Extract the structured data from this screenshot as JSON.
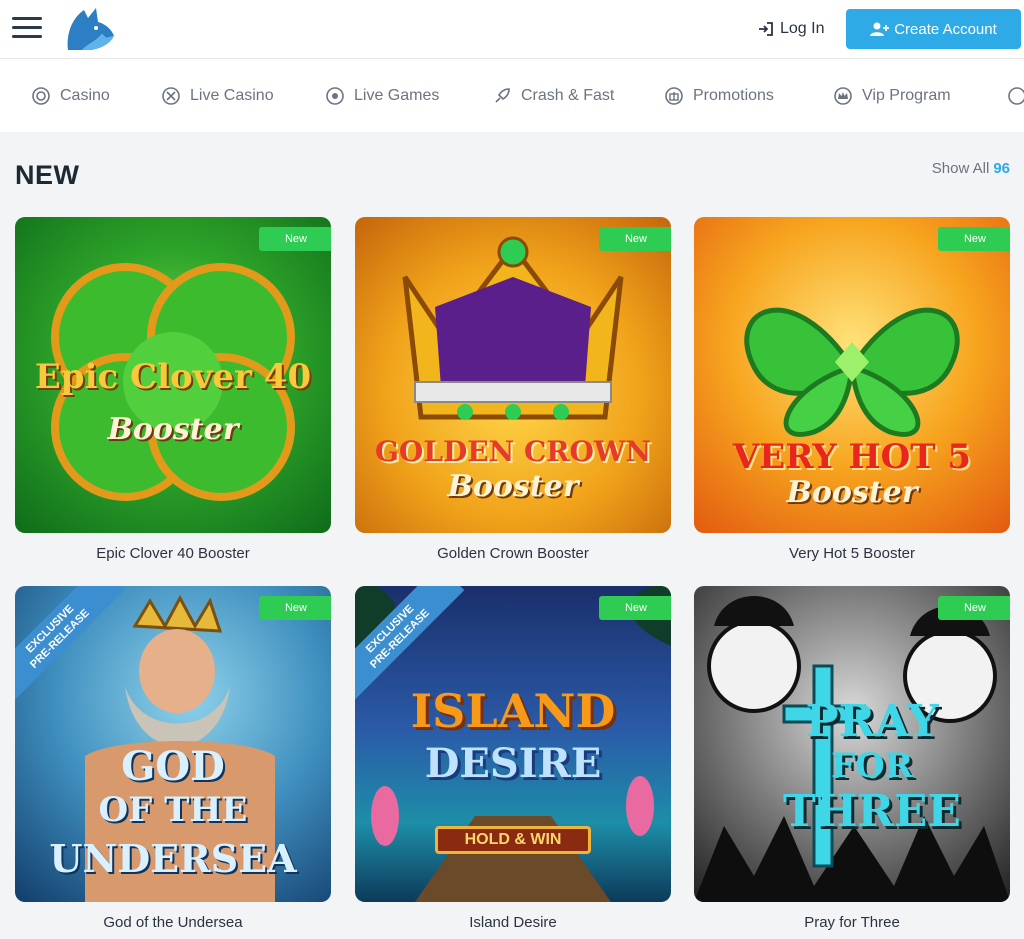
{
  "header": {
    "login_label": "Log In",
    "create_label": "Create Account",
    "logo_icon": "wolf-logo-icon",
    "menu_icon": "hamburger-icon",
    "accent": "#2eabe6"
  },
  "nav": {
    "items": [
      {
        "label": "Casino",
        "icon": "casino-chip-icon"
      },
      {
        "label": "Live Casino",
        "icon": "live-casino-icon"
      },
      {
        "label": "Live Games",
        "icon": "live-games-icon"
      },
      {
        "label": "Crash & Fast",
        "icon": "rocket-icon"
      },
      {
        "label": "Promotions",
        "icon": "gift-icon"
      },
      {
        "label": "Vip Program",
        "icon": "crown-icon"
      }
    ]
  },
  "section": {
    "title": "NEW",
    "show_all_label": "Show All",
    "show_all_count": "96"
  },
  "games": [
    {
      "name": "Epic Clover 40 Booster",
      "badge": "New",
      "art": [
        "Epic Clover 40",
        "Booster"
      ]
    },
    {
      "name": "Golden Crown Booster",
      "badge": "New",
      "art": [
        "GOLDEN CROWN",
        "Booster"
      ]
    },
    {
      "name": "Very Hot 5 Booster",
      "badge": "New",
      "art": [
        "VERY HOT 5",
        "Booster"
      ]
    },
    {
      "name": "God of the Undersea",
      "badge": "New",
      "art": [
        "GOD",
        "OF THE",
        "UNDERSEA"
      ],
      "ribbon": [
        "EXCLUSIVE",
        "PRE-RELEASE"
      ]
    },
    {
      "name": "Island Desire",
      "badge": "New",
      "art": [
        "ISLAND",
        "DESIRE",
        "HOLD & WIN"
      ],
      "ribbon": [
        "EXCLUSIVE",
        "PRE-RELEASE"
      ]
    },
    {
      "name": "Pray for Three",
      "badge": "New",
      "art": [
        "PRAY",
        "FOR",
        "THREE"
      ]
    }
  ]
}
